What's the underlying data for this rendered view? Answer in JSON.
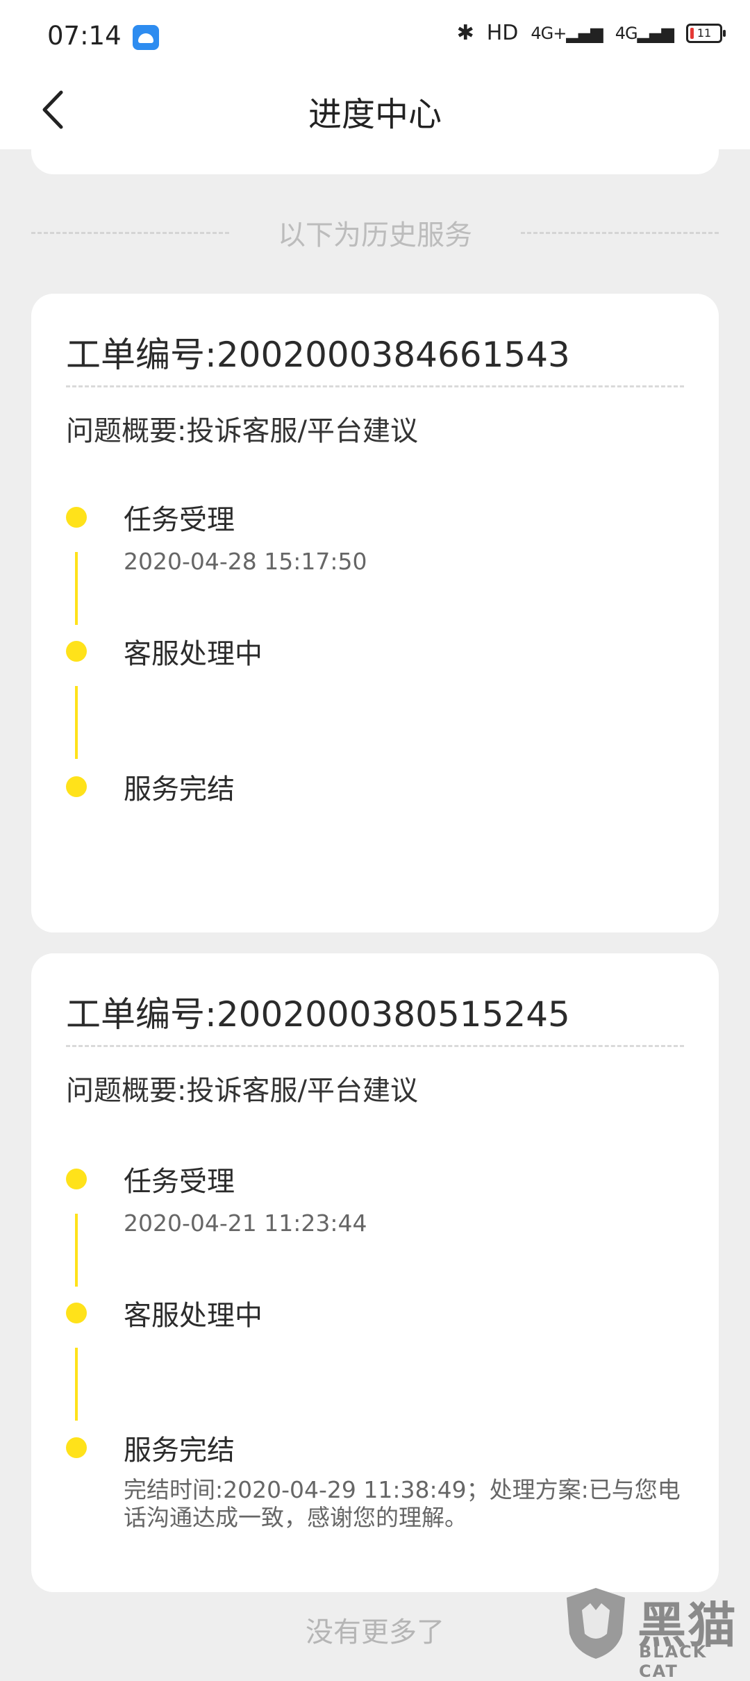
{
  "status_bar": {
    "time": "07:14",
    "bluetooth_icon": "bluetooth-icon",
    "hd": "HD",
    "signal1": "4G+",
    "signal2": "4G",
    "battery": "11"
  },
  "header": {
    "back_icon": "chevron-left-icon",
    "title": "进度中心"
  },
  "history_divider": "以下为历史服务",
  "orders": [
    {
      "order_no": "工单编号:2002000384661543",
      "summary": "问题概要:投诉客服/平台建议",
      "steps": [
        {
          "label": "任务受理",
          "time": "2020-04-28 15:17:50"
        },
        {
          "label": "客服处理中"
        },
        {
          "label": "服务完结"
        }
      ]
    },
    {
      "order_no": "工单编号:2002000380515245",
      "summary": "问题概要:投诉客服/平台建议",
      "steps": [
        {
          "label": "任务受理",
          "time": "2020-04-21 11:23:44"
        },
        {
          "label": "客服处理中"
        },
        {
          "label": "服务完结",
          "note": "完结时间:2020-04-29 11:38:49；处理方案:已与您电话沟通达成一致，感谢您的理解。"
        }
      ]
    }
  ],
  "footer": "没有更多了",
  "watermark": {
    "cn": "黑猫",
    "en": "BLACK CAT"
  },
  "colors": {
    "accent_yellow": "#ffe21a",
    "background": "#eeeeee",
    "card": "#ffffff"
  }
}
